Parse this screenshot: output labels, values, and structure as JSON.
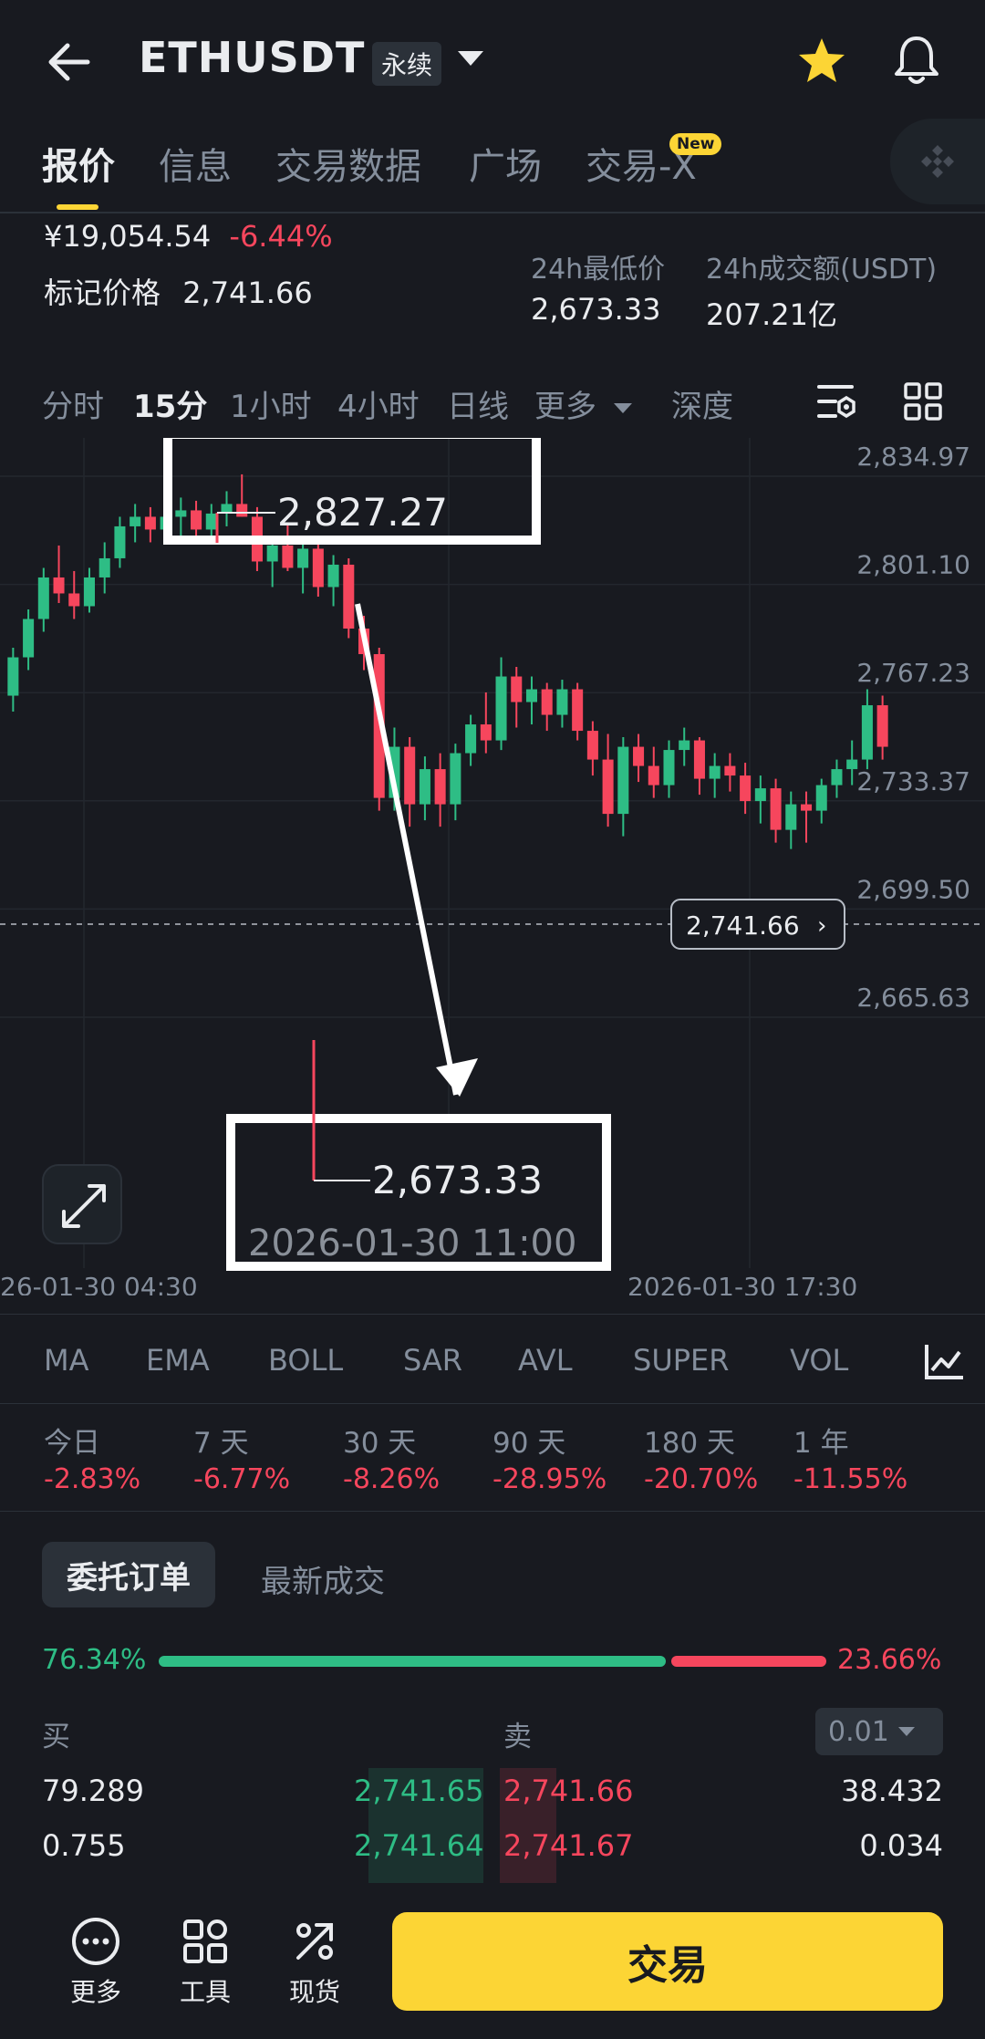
{
  "header": {
    "title": "ETHUSDT",
    "badge": "永续",
    "icons": {
      "back": "back-arrow-icon",
      "dropdown": "chevron-down-icon",
      "favorite": "star-icon",
      "alert": "bell-icon"
    },
    "star_color": "#fcd535"
  },
  "tabs": [
    {
      "label": "报价",
      "active": true
    },
    {
      "label": "信息"
    },
    {
      "label": "交易数据"
    },
    {
      "label": "广场"
    },
    {
      "label": "交易-X",
      "badge": "New"
    }
  ],
  "price": {
    "cny": "¥19,054.54",
    "change": "-6.44%",
    "mark_label": "标记价格",
    "mark_value": "2,741.66",
    "low_label": "24h最低价",
    "low_value": "2,673.33",
    "volume_label": "24h成交额(USDT)",
    "volume_value": "207.21亿"
  },
  "timeframes": [
    {
      "label": "分时"
    },
    {
      "label": "15分",
      "active": true
    },
    {
      "label": "1小时"
    },
    {
      "label": "4小时"
    },
    {
      "label": "日线"
    },
    {
      "label": "更多"
    },
    {
      "label": "深度"
    }
  ],
  "chart_data": {
    "type": "candlestick",
    "y_ticks": [
      "2,834.97",
      "2,801.10",
      "2,767.23",
      "2,733.37",
      "2,699.50",
      "2,665.63"
    ],
    "x_ticks": [
      "26-01-30 04:30",
      "2026-01-30 17:30"
    ],
    "current_price": "2,741.66",
    "high_annotation": "2,827.27",
    "low_annotation": "2,673.33",
    "low_time": "2026-01-30 11:00",
    "ylim": [
      2665.63,
      2834.97
    ],
    "colors": {
      "up": "#2ebd85",
      "down": "#f6465d"
    },
    "candles": [
      [
        2758,
        2773,
        2753,
        2770
      ],
      [
        2770,
        2785,
        2766,
        2782
      ],
      [
        2782,
        2798,
        2778,
        2795
      ],
      [
        2795,
        2805,
        2787,
        2790
      ],
      [
        2790,
        2797,
        2782,
        2786
      ],
      [
        2786,
        2798,
        2784,
        2795
      ],
      [
        2795,
        2806,
        2790,
        2801
      ],
      [
        2801,
        2814,
        2798,
        2811
      ],
      [
        2811,
        2818,
        2806,
        2814
      ],
      [
        2814,
        2817,
        2806,
        2810
      ],
      [
        2810,
        2816,
        2806,
        2814
      ],
      [
        2814,
        2820,
        2808,
        2816
      ],
      [
        2816,
        2819,
        2806,
        2810
      ],
      [
        2810,
        2818,
        2807,
        2815
      ],
      [
        2815,
        2822,
        2811,
        2818
      ],
      [
        2818,
        2827.27,
        2814,
        2814
      ],
      [
        2814,
        2817,
        2797,
        2800
      ],
      [
        2800,
        2806,
        2792,
        2805
      ],
      [
        2805,
        2812,
        2797,
        2798
      ],
      [
        2798,
        2808,
        2790,
        2804
      ],
      [
        2804,
        2808,
        2789,
        2792
      ],
      [
        2792,
        2802,
        2786,
        2799
      ],
      [
        2799,
        2801,
        2776,
        2779
      ],
      [
        2779,
        2783,
        2766,
        2771
      ],
      [
        2771,
        2773,
        2722,
        2726
      ],
      [
        2726,
        2748,
        2722,
        2742
      ],
      [
        2742,
        2745,
        2717,
        2724
      ],
      [
        2724,
        2739,
        2719,
        2735
      ],
      [
        2735,
        2740,
        2717,
        2724
      ],
      [
        2724,
        2743,
        2719,
        2740
      ],
      [
        2740,
        2752,
        2736,
        2749
      ],
      [
        2749,
        2759,
        2740,
        2744
      ],
      [
        2744,
        2770,
        2741,
        2764
      ],
      [
        2764,
        2767,
        2748,
        2756
      ],
      [
        2756,
        2764,
        2749,
        2760
      ],
      [
        2760,
        2762,
        2747,
        2752
      ],
      [
        2752,
        2763,
        2748,
        2760
      ],
      [
        2760,
        2762,
        2744,
        2747
      ],
      [
        2747,
        2750,
        2733,
        2738
      ],
      [
        2738,
        2746,
        2717,
        2721
      ],
      [
        2721,
        2745,
        2714,
        2742
      ],
      [
        2742,
        2746,
        2731,
        2736
      ],
      [
        2736,
        2742,
        2726,
        2730
      ],
      [
        2730,
        2744,
        2726,
        2741
      ],
      [
        2741,
        2748,
        2736,
        2744
      ],
      [
        2744,
        2745,
        2727,
        2732
      ],
      [
        2732,
        2740,
        2726,
        2736
      ],
      [
        2736,
        2740,
        2728,
        2733
      ],
      [
        2733,
        2737,
        2721,
        2725
      ],
      [
        2725,
        2733,
        2718,
        2729
      ],
      [
        2729,
        2732,
        2712,
        2716
      ],
      [
        2716,
        2728,
        2710,
        2724
      ],
      [
        2724,
        2728,
        2712,
        2722
      ],
      [
        2722,
        2732,
        2718,
        2730
      ],
      [
        2730,
        2738,
        2726,
        2735
      ],
      [
        2735,
        2744,
        2730,
        2738
      ],
      [
        2738,
        2760,
        2735,
        2755
      ],
      [
        2755,
        2758,
        2738,
        2742
      ]
    ]
  },
  "indicators": [
    "MA",
    "EMA",
    "BOLL",
    "SAR",
    "AVL",
    "SUPER",
    "VOL"
  ],
  "periods": [
    {
      "label": "今日",
      "value": "-2.83%"
    },
    {
      "label": "7 天",
      "value": "-6.77%"
    },
    {
      "label": "30 天",
      "value": "-8.26%"
    },
    {
      "label": "90 天",
      "value": "-28.95%"
    },
    {
      "label": "180 天",
      "value": "-20.70%"
    },
    {
      "label": "1 年",
      "value": "-11.55%"
    }
  ],
  "orderbook": {
    "tab_active": "委托订单",
    "tab_other": "最新成交",
    "buy_pct": "76.34%",
    "sell_pct": "23.66%",
    "buy_ratio": 0.7634,
    "buy_label": "买",
    "sell_label": "卖",
    "precision": "0.01",
    "rows": [
      {
        "bid_qty": "79.289",
        "bid_price": "2,741.65",
        "ask_price": "2,741.66",
        "ask_qty": "38.432"
      },
      {
        "bid_qty": "0.755",
        "bid_price": "2,741.64",
        "ask_price": "2,741.67",
        "ask_qty": "0.034"
      }
    ]
  },
  "bottom_bar": {
    "more": "更多",
    "tools": "工具",
    "spot": "现货",
    "trade": "交易"
  }
}
